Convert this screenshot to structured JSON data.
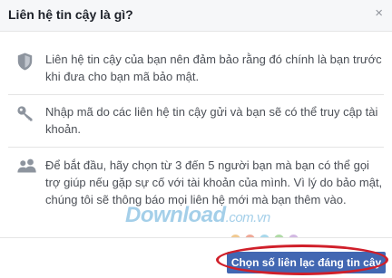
{
  "dialog": {
    "title": "Liên hệ tin cậy là gì?",
    "close_glyph": "×"
  },
  "items": [
    {
      "icon": "shield-icon",
      "text": "Liên hệ tin cậy của bạn nên đảm bảo rằng đó chính là bạn trước khi đưa cho bạn mã bảo mật."
    },
    {
      "icon": "key-icon",
      "text": "Nhập mã do các liên hệ tin cậy gửi và bạn sẽ có thể truy cập tài khoản."
    },
    {
      "icon": "people-icon",
      "text": "Để bắt đầu, hãy chọn từ 3 đến 5 người bạn mà bạn có thể gọi trợ giúp nếu gặp sự cố với tài khoản của mình. Vì lý do bảo mật, chúng tôi sẽ thông báo mọi liên hệ mới mà bạn thêm vào."
    }
  ],
  "footer": {
    "choose_button_label": "Chọn số liên lạc đáng tin cậy"
  },
  "watermark": {
    "main": "Download",
    "suffix": ".com.vn"
  },
  "colors": {
    "button": "#4267b2",
    "highlight": "#d01f2a",
    "watermark": "#5aa9d8"
  }
}
